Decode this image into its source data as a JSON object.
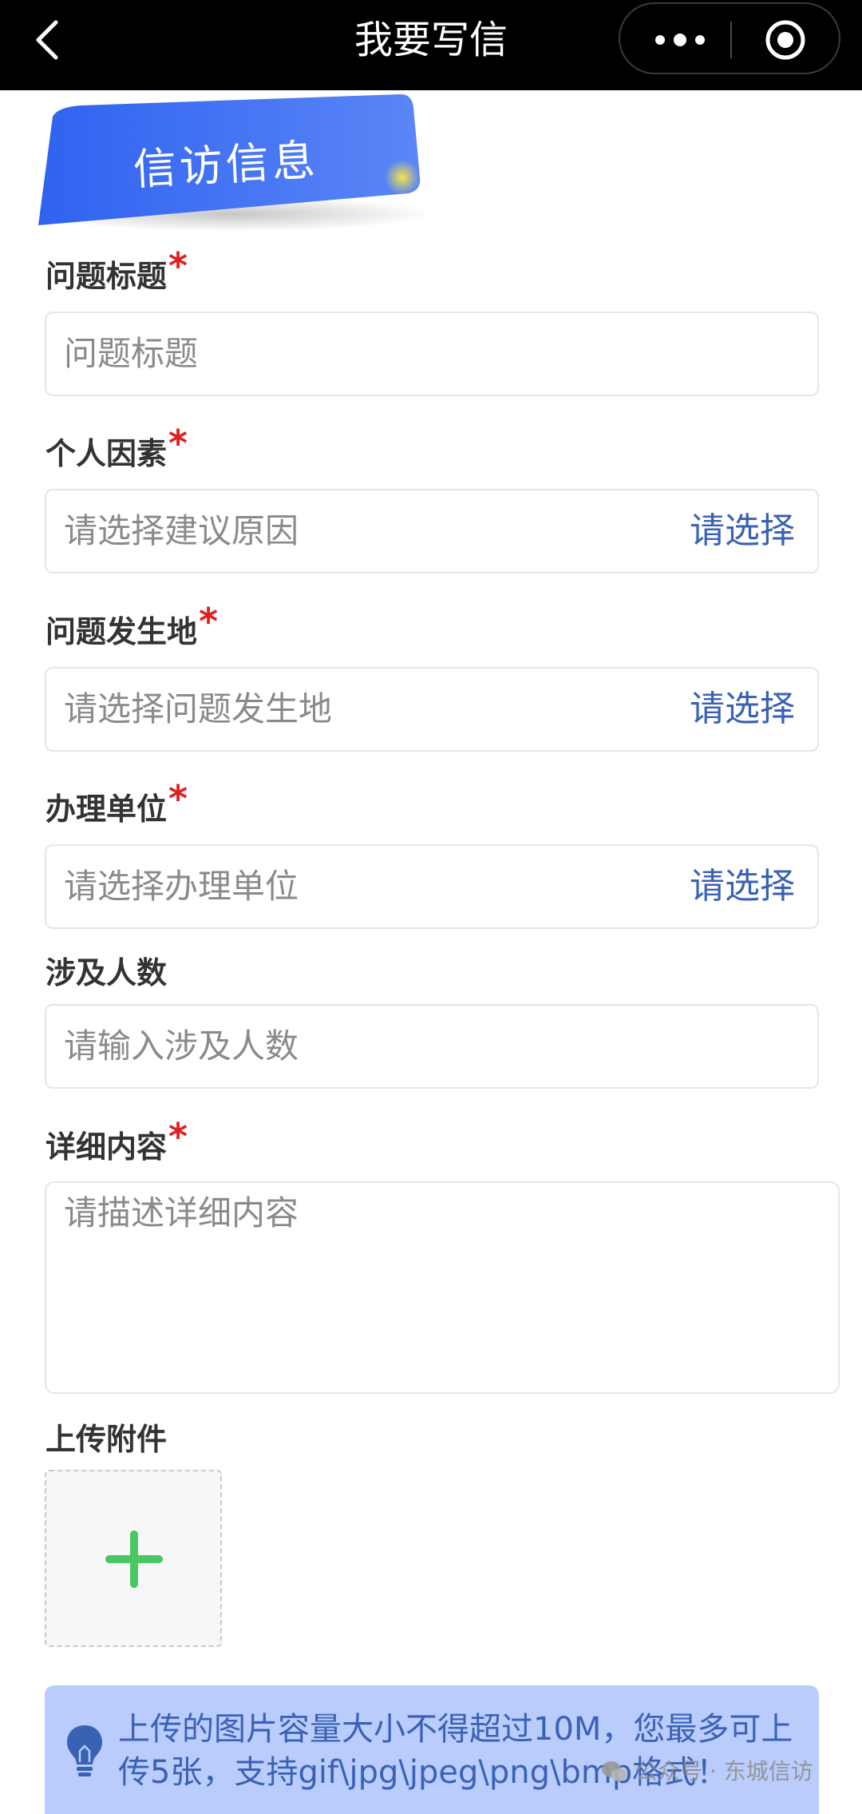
{
  "navbar": {
    "title": "我要写信",
    "back_icon": "chevron-left-icon",
    "more_icon": "more-dots-icon",
    "close_icon": "target-circle-icon"
  },
  "section": {
    "title": "信访信息",
    "badge_color": "#3a6cf0"
  },
  "form": {
    "title_field": {
      "label": "问题标题",
      "required_mark": "*",
      "placeholder": "问题标题"
    },
    "reason_field": {
      "label": "个人因素",
      "required_mark": "*",
      "placeholder": "请选择建议原因",
      "action": "请选择"
    },
    "location_field": {
      "label": "问题发生地",
      "required_mark": "*",
      "placeholder": "请选择问题发生地",
      "action": "请选择"
    },
    "unit_field": {
      "label": "办理单位",
      "required_mark": "*",
      "placeholder": "请选择办理单位",
      "action": "请选择"
    },
    "people_field": {
      "label": "涉及人数",
      "placeholder": "请输入涉及人数"
    },
    "content_field": {
      "label": "详细内容",
      "required_mark": "*",
      "placeholder": "请描述详细内容"
    },
    "attachment": {
      "label": "上传附件",
      "plus_color": "#4cc563"
    }
  },
  "tip": {
    "text": "上传的图片容量大小不得超过10M，您最多可上传5张，支持gif\\jpg\\jpeg\\png\\bmp格式！",
    "icon": "lightbulb-icon"
  },
  "watermark": {
    "text": "公众号 · 东城信访"
  },
  "colors": {
    "accent": "#3a62b4",
    "required": "#e02020",
    "tip_background": "#b9ccfb"
  }
}
